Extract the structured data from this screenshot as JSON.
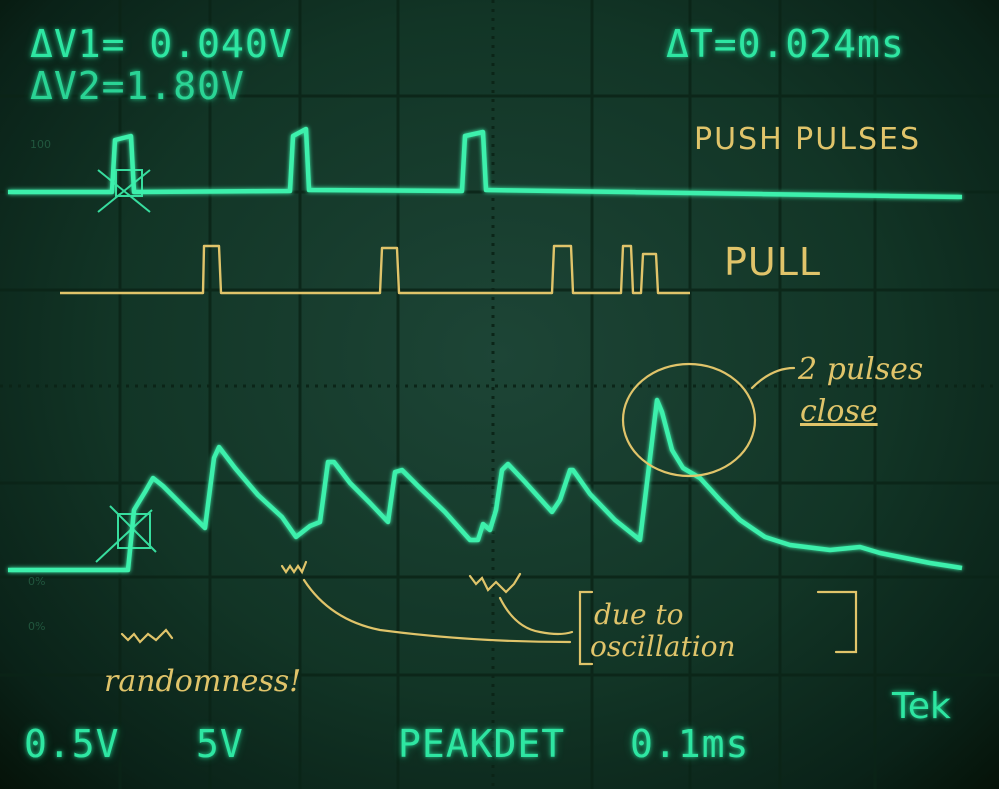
{
  "readouts": {
    "delta_v1": "ΔV1= 0.040V",
    "delta_v2": "ΔV2=1.80V",
    "delta_t": "ΔT=0.024ms",
    "ch1_scale": "0.5V",
    "ch2_scale": "5V",
    "acq_mode": "PEAKDET",
    "timebase": "0.1ms",
    "brand": "Tek"
  },
  "annotations": {
    "push": "PUSH PULSES",
    "pull": "PULL",
    "close_line1": "2 pulses",
    "close_line2": "close",
    "due_line1": "due to",
    "due_line2": "oscillation",
    "randomness": "randomness!"
  },
  "colors": {
    "trace": "#3cf0ac",
    "graticule": "#0b2417",
    "handwriting": "#e0c46a"
  }
}
